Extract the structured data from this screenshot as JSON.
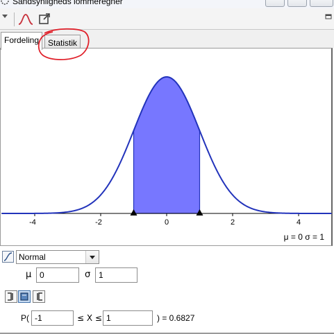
{
  "window": {
    "title": "Sandsynligheds lommeregner"
  },
  "tabs": [
    {
      "label": "Fordeling",
      "active": true
    },
    {
      "label": "Statistik",
      "active": false
    }
  ],
  "toolbar": {
    "menu_icon": "triangle-down-icon",
    "curve_icon": "distribution-curve-icon",
    "export_icon": "export-icon",
    "dock_icon": "undock-icon"
  },
  "chart_data": {
    "type": "area",
    "distribution": "normal",
    "mu": 0,
    "sigma": 1,
    "xlim": [
      -5,
      5
    ],
    "x_ticks": [
      "-4",
      "-2",
      "0",
      "2",
      "4"
    ],
    "shaded_interval": [
      -1,
      1
    ],
    "curve_color": "#2233bb",
    "fill_color": "#7777ff",
    "params_label": "μ = 0   σ = 1"
  },
  "controls": {
    "distribution_value": "Normal",
    "mu_label": "μ",
    "mu_value": "0",
    "sigma_label": "σ",
    "sigma_value": "1",
    "prob_prefix": "P(",
    "low_value": "-1",
    "mid_text": "≤ X ≤",
    "high_value": "1",
    "result_text": ") =  0.6827"
  },
  "colors": {
    "annotation": "#e0202a",
    "accent": "#3d6fa8"
  }
}
